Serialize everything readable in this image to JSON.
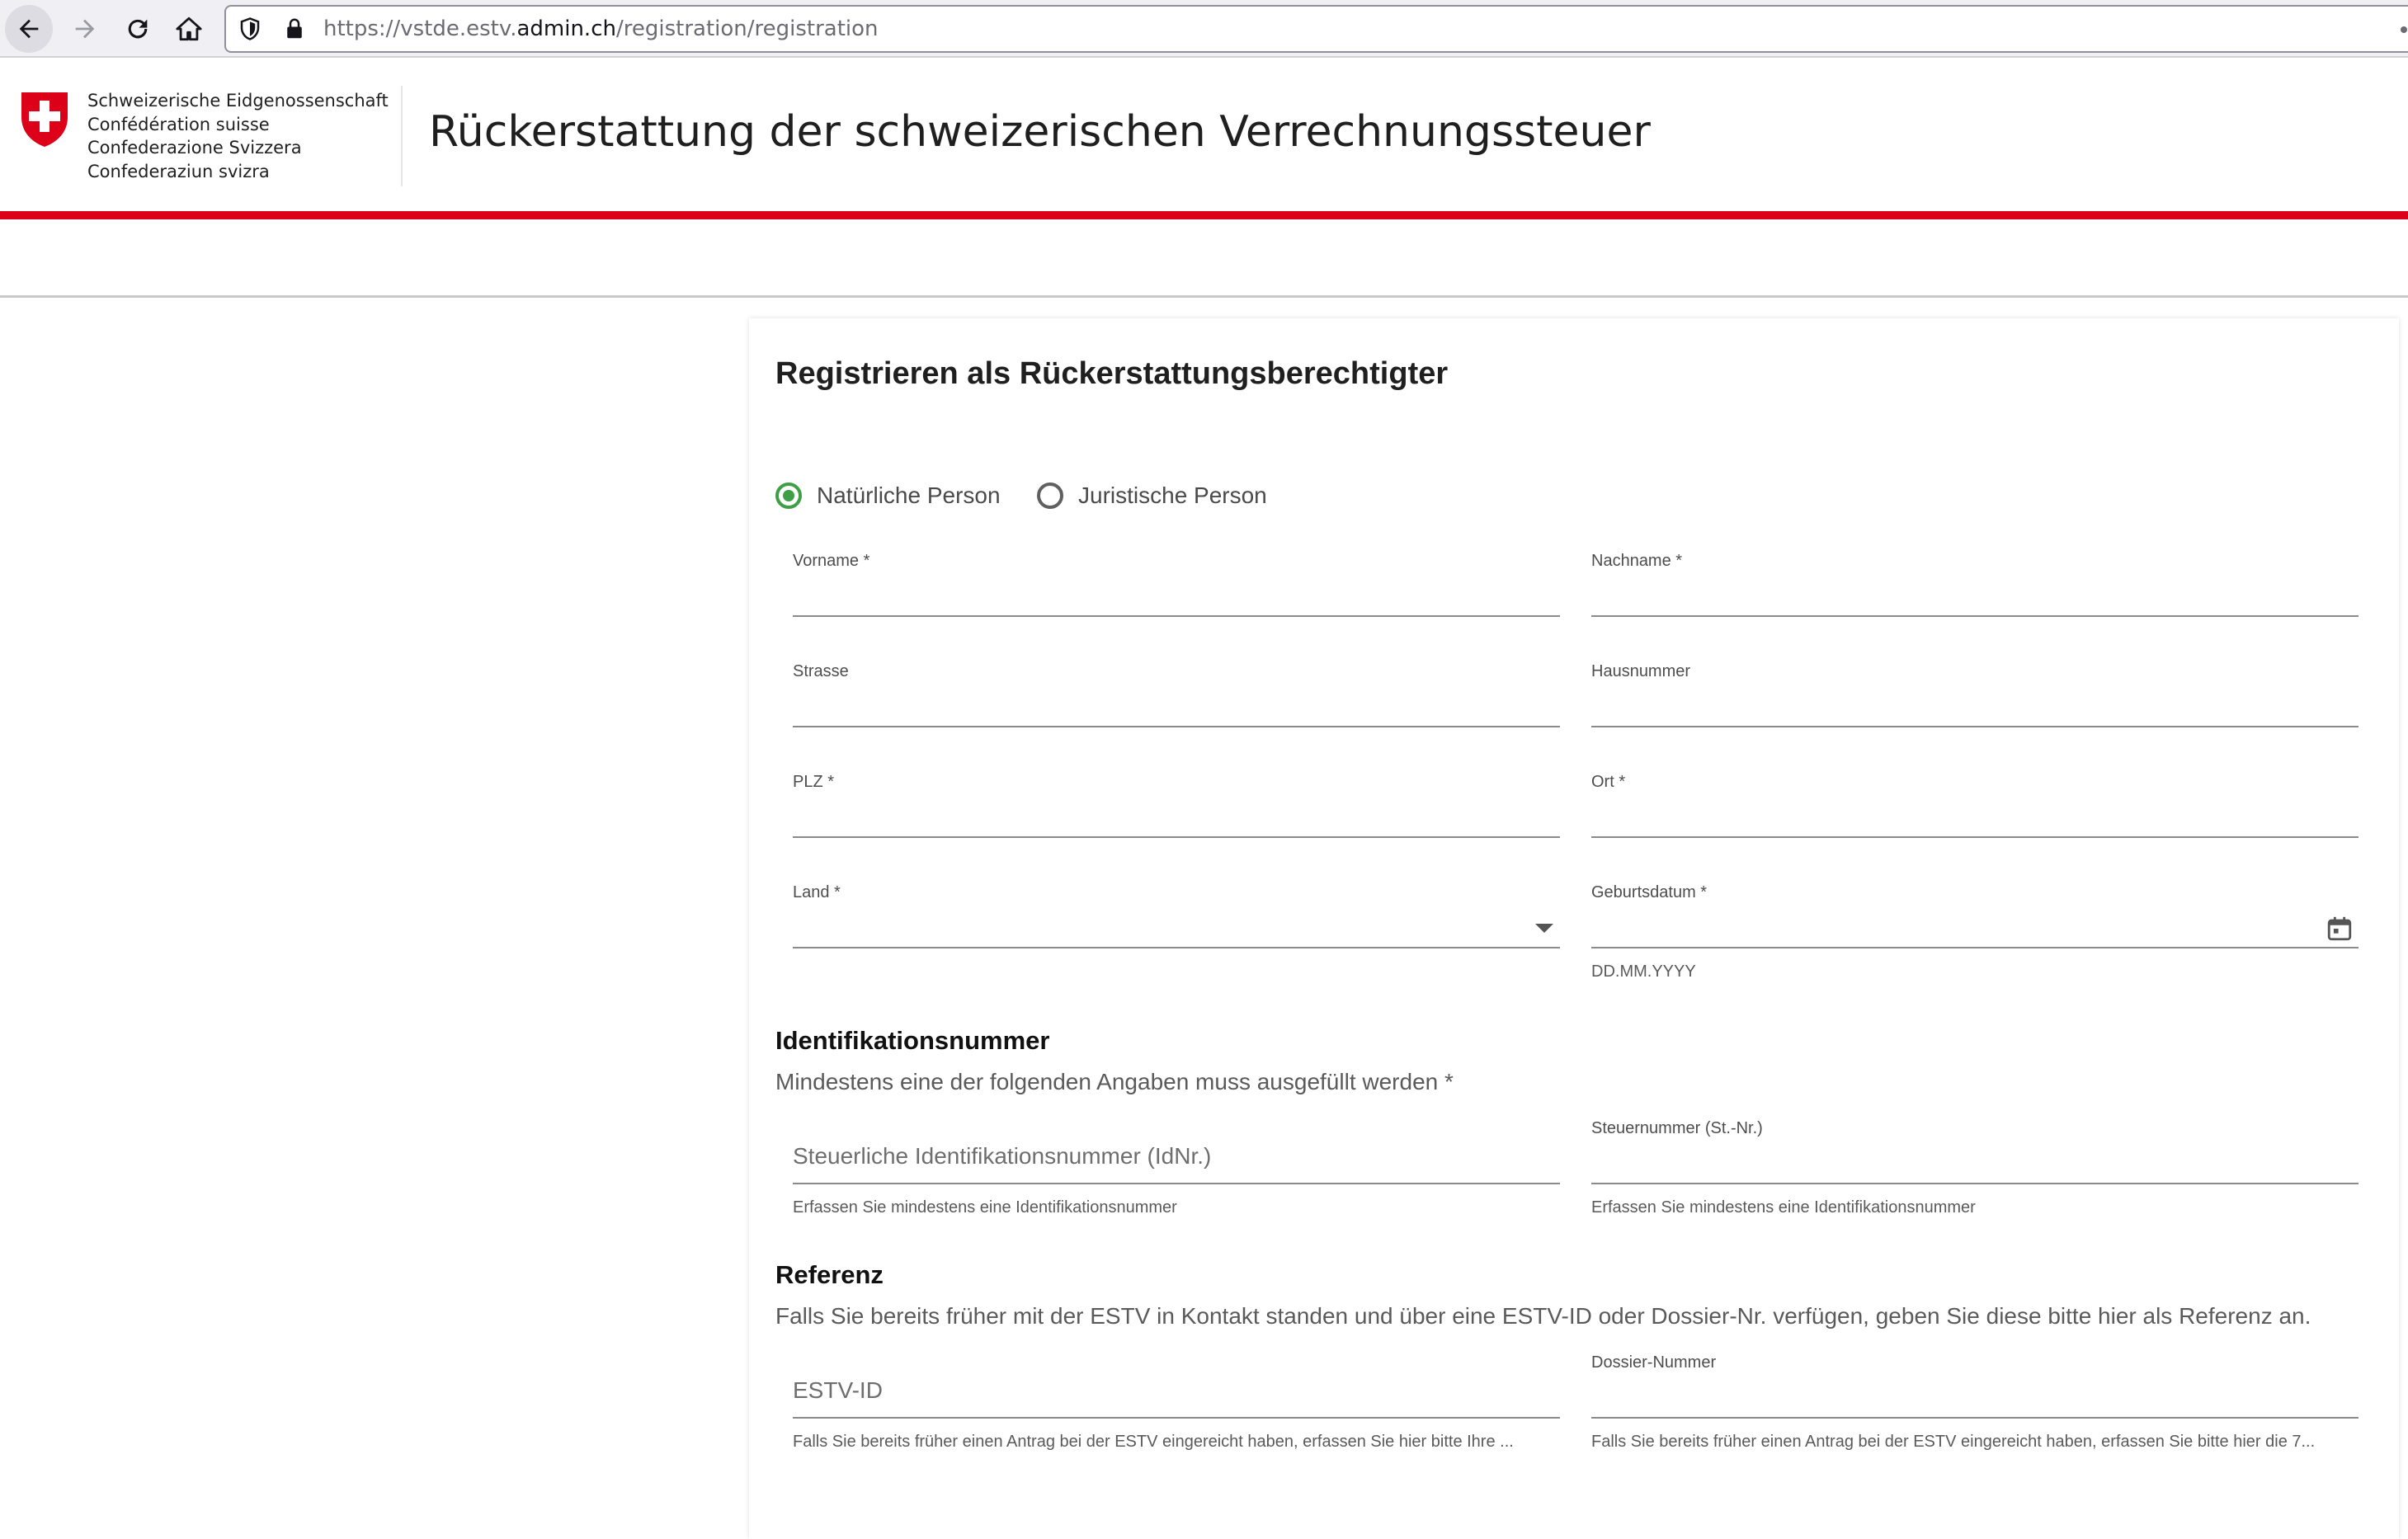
{
  "browser": {
    "url_prefix": "https://vstde.estv.",
    "url_domain": "admin.ch",
    "url_path": "/registration/registration"
  },
  "header": {
    "confederation": [
      "Schweizerische Eidgenossenschaft",
      "Confédération suisse",
      "Confederazione Svizzera",
      "Confederaziun svizra"
    ],
    "title": "Rückerstattung der schweizerischen Verrechnungssteuer"
  },
  "form": {
    "title": "Registrieren als Rückerstattungsberechtigter",
    "person_type": {
      "options": [
        "Natürliche Person",
        "Juristische Person"
      ],
      "selected": "Natürliche Person"
    },
    "fields": {
      "vorname": "Vorname *",
      "nachname": "Nachname *",
      "strasse": "Strasse",
      "hausnummer": "Hausnummer",
      "plz": "PLZ *",
      "ort": "Ort *",
      "land": "Land *",
      "geburtsdatum": "Geburtsdatum *",
      "geburtsdatum_hint": "DD.MM.YYYY"
    },
    "identification": {
      "title": "Identifikationsnummer",
      "subtitle": "Mindestens eine der folgenden Angaben muss ausgefüllt werden *",
      "idnr_placeholder": "Steuerliche Identifikationsnummer (IdNr.)",
      "idnr_hint": "Erfassen Sie mindestens eine Identifikationsnummer",
      "stnr_label": "Steuernummer (St.-Nr.)",
      "stnr_hint": "Erfassen Sie mindestens eine Identifikationsnummer"
    },
    "reference": {
      "title": "Referenz",
      "subtitle": "Falls Sie bereits früher mit der ESTV in Kontakt standen und über eine ESTV-ID oder Dossier-Nr. verfügen, geben Sie diese bitte hier als Referenz an.",
      "estv_placeholder": "ESTV-ID",
      "estv_hint": "Falls Sie bereits früher einen Antrag bei der ESTV eingereicht haben, erfassen Sie hier bitte Ihre ...",
      "dossier_label": "Dossier-Nummer",
      "dossier_hint": "Falls Sie bereits früher einen Antrag bei der ESTV eingereicht haben, erfassen Sie bitte hier die 7..."
    }
  },
  "colors": {
    "swiss_red": "#dc0018",
    "radio_green": "#3e9f47"
  }
}
